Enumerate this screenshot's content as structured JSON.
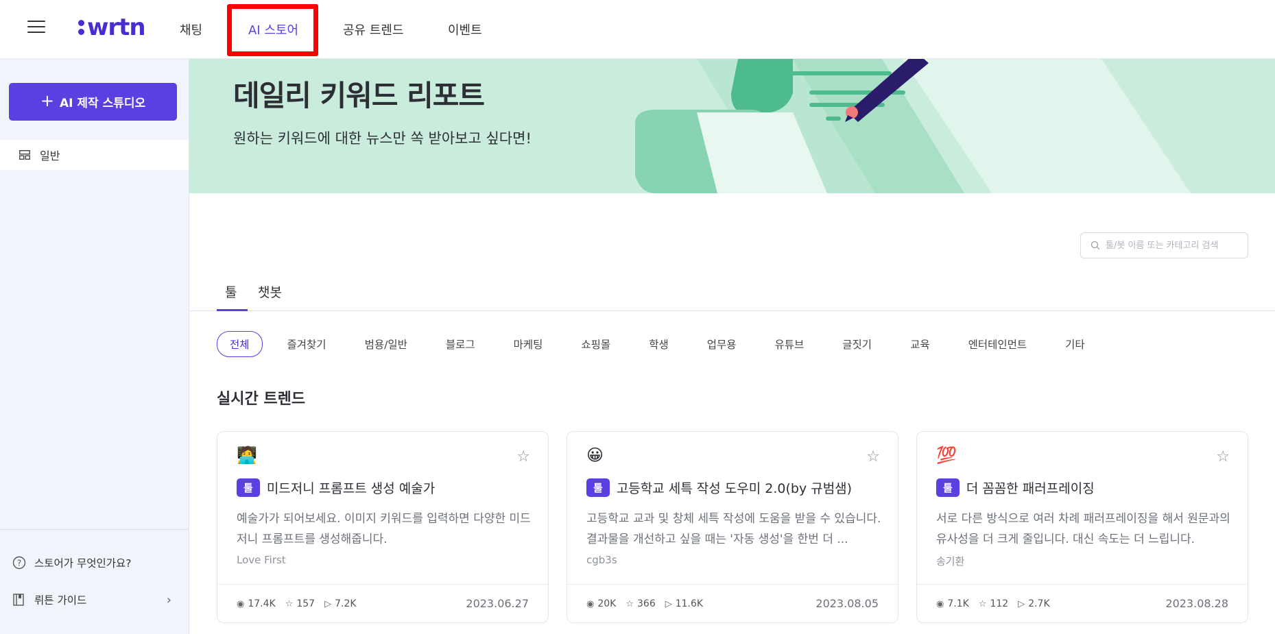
{
  "header": {
    "logo_text": "wrtn",
    "nav": [
      "채팅",
      "AI 스토어",
      "공유 트렌드",
      "이벤트"
    ],
    "active_nav": "AI 스토어",
    "accent": "#5b3fe0"
  },
  "sidebar": {
    "studio_button": "AI 제작 스튜디오",
    "items": [
      {
        "label": "일반",
        "icon": "grid-icon"
      }
    ],
    "bottom": [
      {
        "label": "스토어가 무엇인가요?",
        "icon": "question-circle-icon"
      },
      {
        "label": "뤼튼 가이드",
        "icon": "book-icon"
      }
    ]
  },
  "banner": {
    "title": "데일리 키워드 리포트",
    "subtitle": "원하는 키워드에 대한 뉴스만 쏙 받아보고 싶다면!",
    "bg_color": "#c9ecdd"
  },
  "search": {
    "placeholder": "툴/봇 이름 또는 카테고리 검색"
  },
  "tabs": [
    "툴",
    "챗봇"
  ],
  "active_tab": "툴",
  "categories": [
    "전체",
    "즐겨찾기",
    "범용/일반",
    "블로그",
    "마케팅",
    "쇼핑몰",
    "학생",
    "업무용",
    "유튜브",
    "글짓기",
    "교육",
    "엔터테인먼트",
    "기타"
  ],
  "active_category": "전체",
  "section_title": "실시간 트렌드",
  "cards": [
    {
      "emoji": "🧑‍💻",
      "badge": "툴",
      "title": "미드저니 프롬프트 생성 예술가",
      "desc": "예술가가 되어보세요. 이미지 키워드를 입력하면 다양한 미드저니 프롬프트를 생성해줍니다.",
      "author": "Love First",
      "views": "17.4K",
      "stars": "157",
      "runs": "7.2K",
      "date": "2023.06.27"
    },
    {
      "emoji": "😀",
      "badge": "툴",
      "title": "고등학교 세특 작성 도우미 2.0(by 규범샘)",
      "desc": "고등학교 교과 및 창체 세특 작성에 도움을 받을 수 있습니다. 결과물을 개선하고 싶을 때는 '자동 생성'을 한번 더 ...",
      "author": "cgb3s",
      "views": "20K",
      "stars": "366",
      "runs": "11.6K",
      "date": "2023.08.05"
    },
    {
      "emoji": "💯",
      "badge": "툴",
      "title": "더 꼼꼼한 패러프레이징",
      "desc": "서로 다른 방식으로 여러 차례 패러프레이징을 해서 원문과의 유사성을 더 크게 줄입니다. 대신 속도는 더 느립니다.",
      "author": "송기환",
      "views": "7.1K",
      "stars": "112",
      "runs": "2.7K",
      "date": "2023.08.28"
    }
  ]
}
